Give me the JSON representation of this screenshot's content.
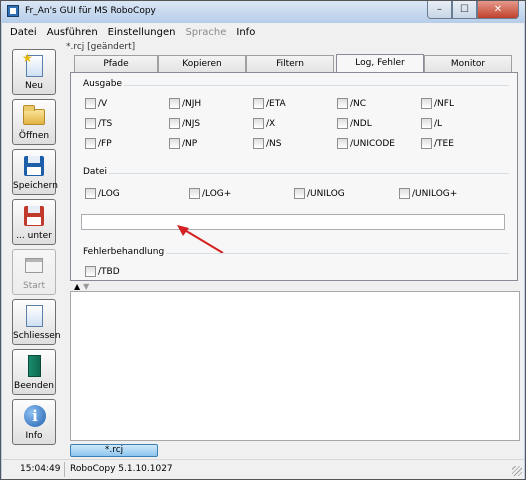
{
  "window": {
    "title": "Fr_An's GUI für MS RoboCopy",
    "app_icon": "app-icon"
  },
  "window_controls": {
    "minimize": "–",
    "maximize": "☐",
    "close": "✕"
  },
  "menu": [
    "Datei",
    "Ausführen",
    "Einstellungen",
    "Sprache",
    "Info"
  ],
  "menu_state": {
    "disabled": [
      "Sprache"
    ]
  },
  "toolbar": [
    {
      "label": "Neu",
      "icon": "new-document-icon",
      "enabled": true
    },
    {
      "label": "Öffnen",
      "icon": "folder-icon",
      "enabled": true
    },
    {
      "label": "Speichern",
      "icon": "save-disk-icon",
      "enabled": true
    },
    {
      "label": "... unter",
      "icon": "save-as-disk-icon",
      "enabled": true
    },
    {
      "label": "Start",
      "icon": "window-icon",
      "enabled": false
    },
    {
      "label": "Schliessen",
      "icon": "close-document-icon",
      "enabled": true
    },
    {
      "label": "Beenden",
      "icon": "exit-door-icon",
      "enabled": true
    },
    {
      "label": "Info",
      "icon": "info-icon",
      "enabled": true
    }
  ],
  "document": {
    "title": "*.rcj [geändert]",
    "tab_label": "*.rcj"
  },
  "tabs": [
    "Pfade",
    "Kopieren",
    "Filtern",
    "Log, Fehler",
    "Monitor"
  ],
  "active_tab": "Log, Fehler",
  "ausgabe": {
    "label": "Ausgabe",
    "options": [
      "/V",
      "/NJH",
      "/ETA",
      "/NC",
      "/NFL",
      "/TS",
      "/NJS",
      "/X",
      "/NDL",
      "/L",
      "/FP",
      "/NP",
      "/NS",
      "/UNICODE",
      "/TEE"
    ]
  },
  "datei": {
    "label": "Datei",
    "options": [
      "/LOG",
      "/LOG+",
      "/UNILOG",
      "/UNILOG+"
    ],
    "logfile_value": ""
  },
  "fehler": {
    "label": "Fehlerbehandlung",
    "options": [
      "/TBD"
    ]
  },
  "annotation": {
    "color": "#d42020"
  },
  "status": {
    "time": "15:04:49",
    "version": "RoboCopy 5.1.10.1027"
  }
}
